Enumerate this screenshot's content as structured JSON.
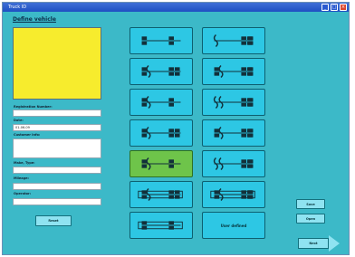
{
  "window": {
    "title": "Truck ID"
  },
  "page": {
    "heading": "Define vehicle"
  },
  "form": {
    "registration_label": "Registration Number:",
    "registration_value": "",
    "date_label": "Date:",
    "date_value": "01-06-09",
    "customer_label": "Customer Info:",
    "customer_value": "",
    "make_label": "Make, Type:",
    "make_value": "",
    "mileage_label": "Mileage:",
    "mileage_value": "",
    "operator_label": "Operator:",
    "operator_value": ""
  },
  "buttons": {
    "left": "Reset",
    "right_top": "Save",
    "right_middle": "Open",
    "next": "Next",
    "user_defined": "User defined"
  },
  "configurations": {
    "selected_index": 8,
    "count": 14
  },
  "colors": {
    "background": "#3cb9c8",
    "tile": "#2dc7e4",
    "selected_tile": "#6ec44a",
    "preview": "#f7ec2d"
  }
}
